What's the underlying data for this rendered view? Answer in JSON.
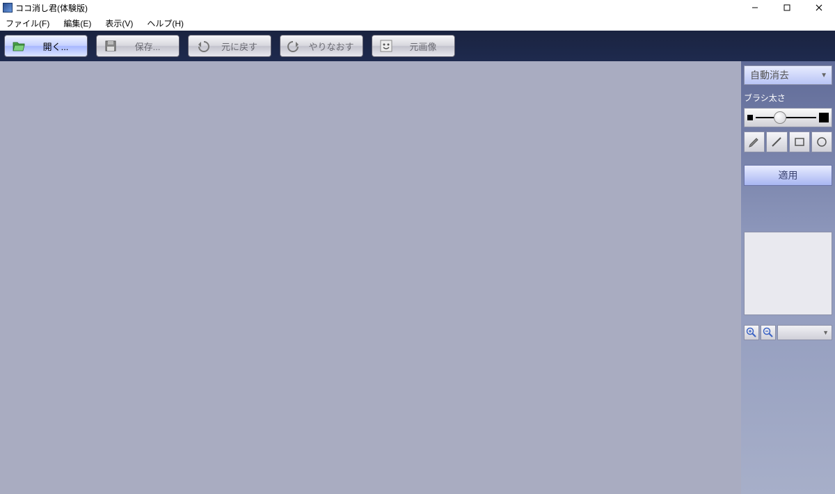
{
  "title": "ココ消し君(体験版)",
  "menu": {
    "file": "ファイル(F)",
    "edit": "編集(E)",
    "view": "表示(V)",
    "help": "ヘルプ(H)"
  },
  "toolbar": {
    "open": "開く...",
    "save": "保存...",
    "undo": "元に戻す",
    "redo": "やりなおす",
    "original": "元画像"
  },
  "sidepanel": {
    "mode_selected": "自動消去",
    "brush_label": "ブラシ太さ",
    "apply": "適用"
  }
}
